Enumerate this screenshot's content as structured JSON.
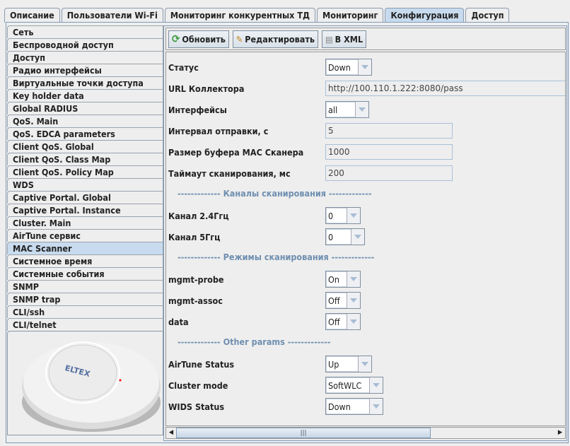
{
  "tabs": [
    "Описание",
    "Пользователи Wi-Fi",
    "Мониторинг конкурентных ТД",
    "Мониторинг",
    "Конфигурация",
    "Доступ"
  ],
  "active_tab": "Конфигурация",
  "nav": [
    "Сеть",
    "Беспроводной доступ",
    "Доступ",
    "Радио интерфейсы",
    "Виртуальные точки доступа",
    "Key holder data",
    "Global RADIUS",
    "QoS. Main",
    "QoS. EDCA parameters",
    "Client QoS. Global",
    "Client QoS. Class Map",
    "Client QoS. Policy Map",
    "WDS",
    "Captive Portal. Global",
    "Captive Portal. Instance",
    "Cluster. Main",
    "AirTune сервис",
    "MAC Scanner",
    "Системное время",
    "Системные события",
    "SNMP",
    "SNMP trap",
    "CLI/ssh",
    "CLI/telnet"
  ],
  "selected_nav": "MAC Scanner",
  "device_logo": "ELTEX",
  "toolbar": {
    "refresh": "Обновить",
    "edit": "Редактировать",
    "xml": "В XML"
  },
  "form": {
    "status": {
      "label": "Статус",
      "value": "Down"
    },
    "url": {
      "label": "URL Коллектора",
      "value": "http://100.110.1.222:8080/pass"
    },
    "interfaces": {
      "label": "Интерфейсы",
      "value": "all"
    },
    "interval": {
      "label": "Интервал отправки, с",
      "value": "5"
    },
    "buffer": {
      "label": "Размер буфера MAC Сканера",
      "value": "1000"
    },
    "timeout": {
      "label": "Таймаут сканирования, мс",
      "value": "200"
    },
    "sec_channels": "------------- Каналы сканирования -------------",
    "ch24": {
      "label": "Канал 2.4Ггц",
      "value": "0"
    },
    "ch5": {
      "label": "Канал 5Ггц",
      "value": "0"
    },
    "sec_modes": "------------- Режимы сканирования -------------",
    "mgmt_probe": {
      "label": "mgmt-probe",
      "value": "On"
    },
    "mgmt_assoc": {
      "label": "mgmt-assoc",
      "value": "Off"
    },
    "data": {
      "label": "data",
      "value": "Off"
    },
    "sec_other": "------------- Other params -------------",
    "airtune": {
      "label": "AirTune Status",
      "value": "Up"
    },
    "cluster": {
      "label": "Cluster mode",
      "value": "SoftWLC"
    },
    "wids": {
      "label": "WIDS Status",
      "value": "Down"
    }
  }
}
